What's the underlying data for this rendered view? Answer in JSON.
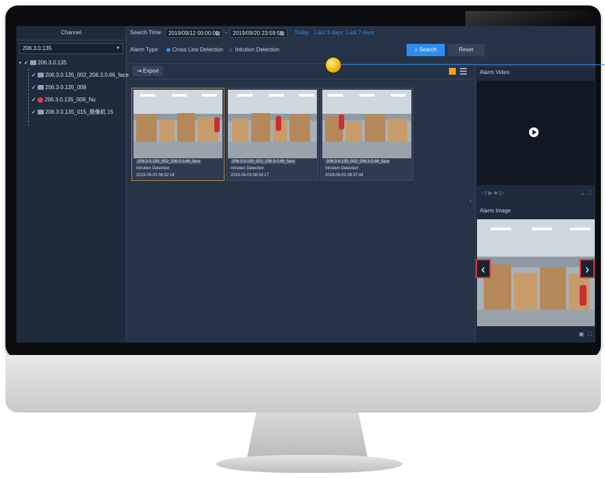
{
  "left_panel": {
    "title": "Channel",
    "selected_device": "206.3.0.135",
    "root_node": "206.3.0.135",
    "channels": [
      {
        "label": "206.3.0.135_002_206.3.0.66_face",
        "icon": "camera-icon"
      },
      {
        "label": "206.3.0.135_008",
        "icon": "camera-icon"
      },
      {
        "label": "206.3.0.135_009_Nu",
        "icon": "camera-alarm-icon"
      },
      {
        "label": "206.3.0.135_015_摄像机 15",
        "icon": "camera-icon"
      }
    ]
  },
  "search": {
    "label": "Search Time:",
    "start": "2019/09/12 00:00:00",
    "separator": "-",
    "end": "2019/09/20 23:59:59",
    "quick": [
      "Today",
      "Last 3 days",
      "Last 7 days"
    ],
    "alarm_type_label": "Alarm Type:",
    "alarm_types": [
      {
        "label": "Cross Line Detection",
        "selected": true
      },
      {
        "label": "Intrution Detection",
        "selected": false
      }
    ],
    "search_button": "Search",
    "reset_button": "Reset"
  },
  "toolbar": {
    "export_label": "Export"
  },
  "results": [
    {
      "channel": "206.3.0.135_002_206.3.0.66_face",
      "type": "Intrution Detection",
      "time": "2019-09-03 08:32:16"
    },
    {
      "channel": "206.3.0.135_002_206.3.0.66_face",
      "type": "Intrution Detection",
      "time": "2019-09-03 08:34:17"
    },
    {
      "channel": "206.3.0.135_002_206.3.0.66_face",
      "type": "Intrution Detection",
      "time": "2019-09-03 08:37:44"
    }
  ],
  "right_panel": {
    "video_title": "Alarm Video",
    "image_title": "Alarm Image"
  },
  "colors": {
    "accent": "#2e8cf0",
    "panel": "#1f2a3c",
    "screen": "#263246",
    "highlight": "#f0a020",
    "nav_border": "#d8343f"
  }
}
